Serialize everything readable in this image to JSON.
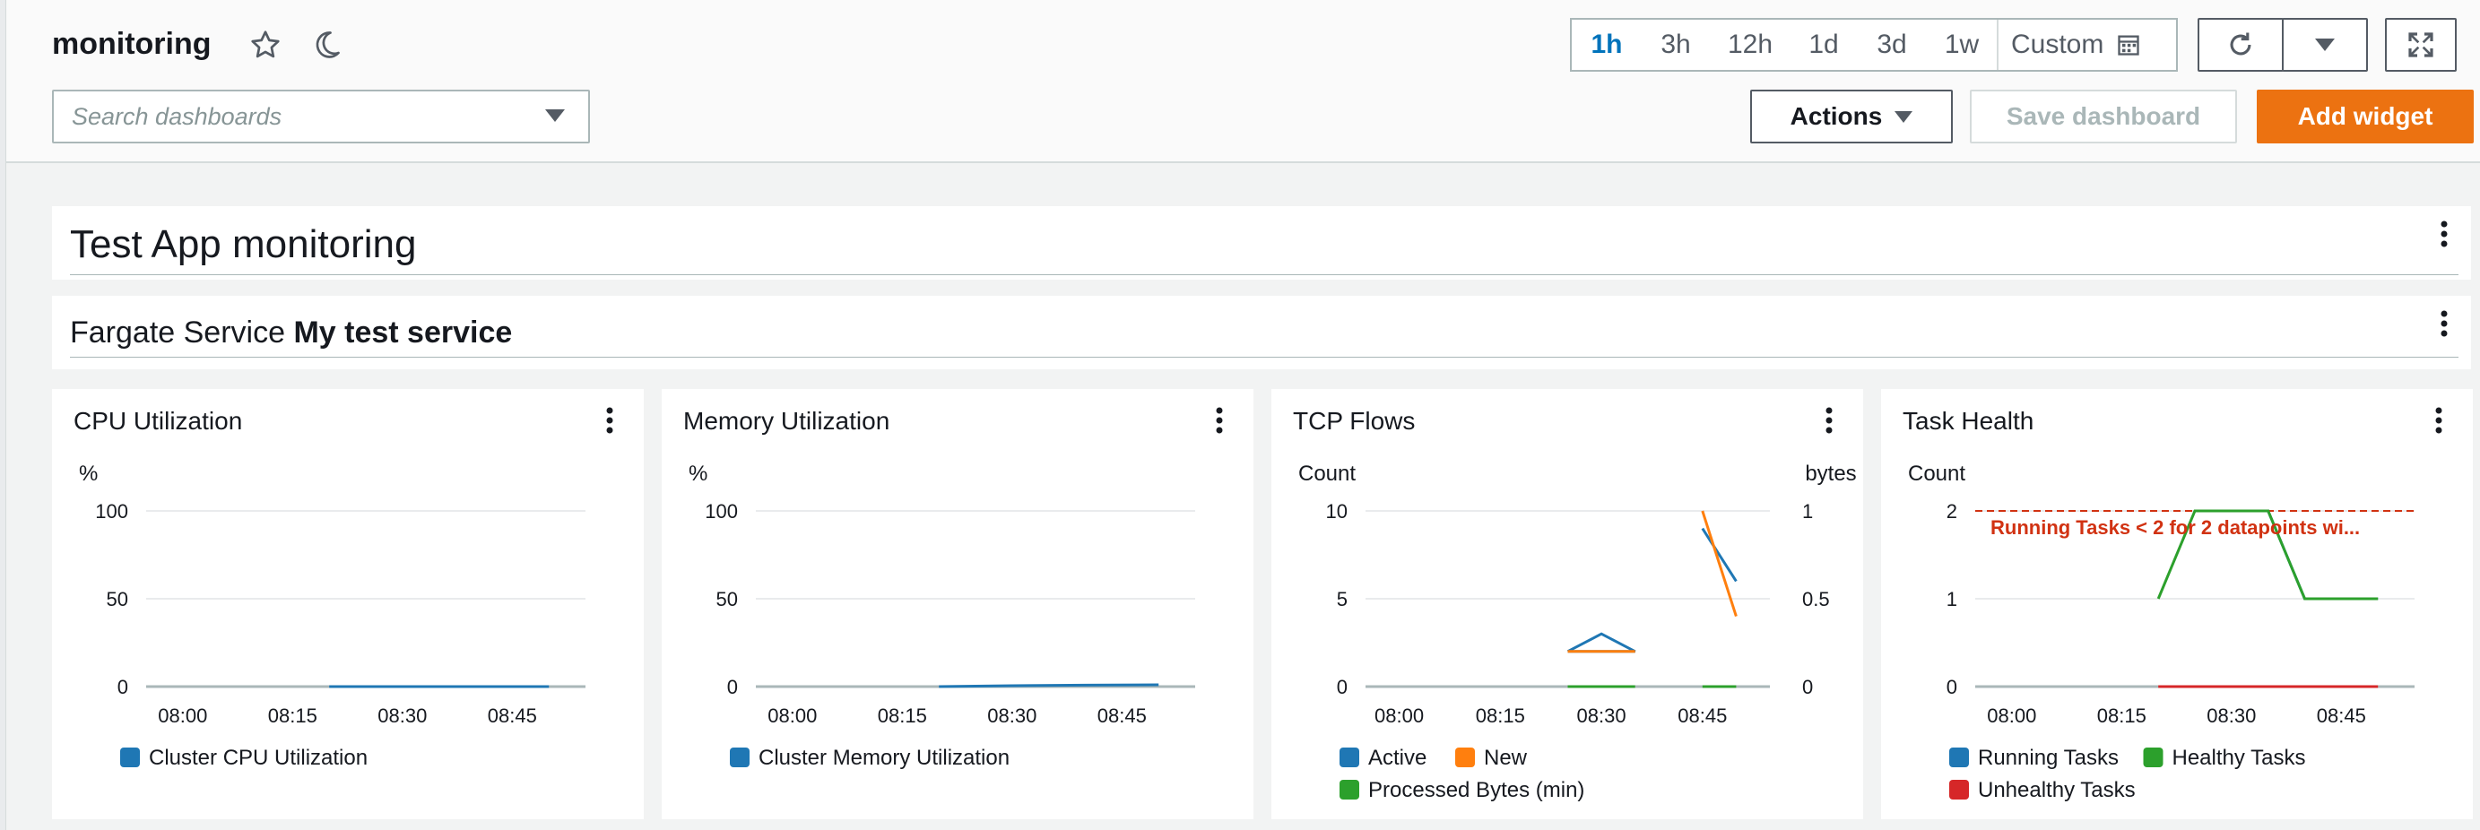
{
  "header": {
    "title": "monitoring",
    "search_placeholder": "Search dashboards",
    "time_ranges": [
      "1h",
      "3h",
      "12h",
      "1d",
      "3d",
      "1w"
    ],
    "selected_range": "1h",
    "custom_label": "Custom",
    "actions_label": "Actions",
    "save_label": "Save dashboard",
    "add_widget_label": "Add widget"
  },
  "text_widgets": {
    "app_title": "Test App monitoring",
    "service_prefix": "Fargate Service",
    "service_name": "My test service"
  },
  "colors": {
    "accent": "#ec7211",
    "selected": "#0073bb",
    "series_blue": "#1f77b4",
    "series_orange": "#ff7f0e",
    "series_green": "#2ca02c",
    "series_red": "#d62728",
    "alarm_red": "#d13212"
  },
  "icons": [
    "star-icon",
    "moon-icon",
    "calendar-icon",
    "refresh-icon",
    "caret-down-icon",
    "fullscreen-icon",
    "kebab-icon"
  ],
  "chart_data": [
    {
      "type": "line",
      "title": "CPU Utilization",
      "ylabel": "%",
      "ylim": [
        0,
        100
      ],
      "yticks": [
        "100",
        "50",
        "0"
      ],
      "x": [
        "08:00",
        "08:15",
        "08:30",
        "08:45"
      ],
      "series": [
        {
          "name": "Cluster CPU Utilization",
          "color": "#1f77b4",
          "points": [
            [
              "08:20",
              0
            ],
            [
              "08:25",
              0
            ],
            [
              "08:30",
              0
            ],
            [
              "08:35",
              0
            ],
            [
              "08:40",
              0
            ],
            [
              "08:45",
              0
            ],
            [
              "08:50",
              0
            ]
          ]
        }
      ]
    },
    {
      "type": "line",
      "title": "Memory Utilization",
      "ylabel": "%",
      "ylim": [
        0,
        100
      ],
      "yticks": [
        "100",
        "50",
        "0"
      ],
      "x": [
        "08:00",
        "08:15",
        "08:30",
        "08:45"
      ],
      "series": [
        {
          "name": "Cluster Memory Utilization",
          "color": "#1f77b4",
          "points": [
            [
              "08:20",
              0
            ],
            [
              "08:30",
              0.5
            ],
            [
              "08:40",
              0.8
            ],
            [
              "08:50",
              1
            ]
          ]
        }
      ]
    },
    {
      "type": "line",
      "title": "TCP Flows",
      "ylabel": "Count",
      "ylabel_right": "bytes",
      "ylim": [
        0,
        10
      ],
      "ylim_right": [
        0,
        1
      ],
      "yticks": [
        "10",
        "5",
        "0"
      ],
      "yticks_right": [
        "1",
        "0.5",
        "0"
      ],
      "x": [
        "08:00",
        "08:15",
        "08:30",
        "08:45"
      ],
      "series": [
        {
          "name": "Active",
          "color": "#1f77b4",
          "points": [
            [
              "08:25",
              2
            ],
            [
              "08:30",
              3
            ],
            [
              "08:35",
              2
            ],
            [
              "08:25",
              2
            ]
          ],
          "points2": [
            [
              "08:45",
              9
            ],
            [
              "08:50",
              6
            ]
          ]
        },
        {
          "name": "New",
          "color": "#ff7f0e",
          "points": [
            [
              "08:25",
              2
            ],
            [
              "08:30",
              2
            ],
            [
              "08:35",
              2
            ],
            [
              "08:25",
              2
            ]
          ],
          "points2": [
            [
              "08:45",
              10
            ],
            [
              "08:50",
              4
            ]
          ]
        },
        {
          "name": "Processed Bytes (min)",
          "color": "#2ca02c",
          "points": [
            [
              "08:25",
              0
            ],
            [
              "08:35",
              0
            ]
          ],
          "points2": [
            [
              "08:45",
              0
            ],
            [
              "08:50",
              0
            ]
          ]
        }
      ]
    },
    {
      "type": "line",
      "title": "Task Health",
      "ylabel": "Count",
      "ylim": [
        0,
        2
      ],
      "yticks": [
        "2",
        "1",
        "0"
      ],
      "x": [
        "08:00",
        "08:15",
        "08:30",
        "08:45"
      ],
      "annotation": "Running Tasks < 2 for 2 datapoints wi...",
      "threshold": 2,
      "series": [
        {
          "name": "Running Tasks",
          "color": "#1f77b4",
          "points": [
            [
              "08:25",
              2
            ],
            [
              "08:35",
              2
            ],
            [
              "08:40",
              1
            ],
            [
              "08:50",
              1
            ]
          ]
        },
        {
          "name": "Healthy Tasks",
          "color": "#2ca02c",
          "points": [
            [
              "08:20",
              1
            ],
            [
              "08:25",
              2
            ],
            [
              "08:35",
              2
            ],
            [
              "08:40",
              1
            ],
            [
              "08:50",
              1
            ]
          ]
        },
        {
          "name": "Unhealthy Tasks",
          "color": "#d62728",
          "points": [
            [
              "08:20",
              0
            ],
            [
              "08:50",
              0
            ]
          ]
        }
      ]
    }
  ]
}
